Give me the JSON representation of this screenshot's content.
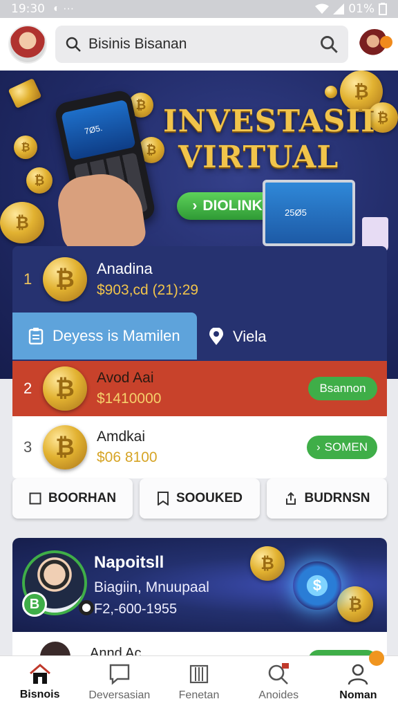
{
  "status": {
    "time": "19:30",
    "battery": "01%"
  },
  "header": {
    "search_text": "Bisinis Bisanan"
  },
  "hero": {
    "title_line1": "INVESTASII",
    "title_line2": "VIRTUAL",
    "cta_label": "DIOLINKS",
    "phone_screen": "7Ø5.",
    "laptop_screen": "25Ø5"
  },
  "list": {
    "rows": [
      {
        "rank": "1",
        "name": "Anadina",
        "value": "$903,cd (21):29"
      },
      {
        "rank": "2",
        "name": "Avod Aai",
        "value": "$1410000",
        "action": "Bsannon"
      },
      {
        "rank": "3",
        "name": "Amdkai",
        "value": "$06 8100",
        "action": "SOMEN"
      }
    ],
    "tabs": [
      {
        "label": "Deyess is Mamilen"
      },
      {
        "label": "Viela"
      }
    ]
  },
  "actions": [
    {
      "label": "BOORHAN"
    },
    {
      "label": "SOOUKED"
    },
    {
      "label": "BUDRNSN"
    }
  ],
  "featured": {
    "title": "Napoitsll",
    "subtitle": "Biagiin, Mnuupaal",
    "phone": "F2,-600-1955",
    "badge": "B",
    "glow_symbol": "$"
  },
  "peek": {
    "name": "Annd Ac"
  },
  "bottom_nav": [
    {
      "label": "Bisnois",
      "icon": "home-icon",
      "active": true
    },
    {
      "label": "Deversasian",
      "icon": "chat-icon",
      "active": false
    },
    {
      "label": "Fenetan",
      "icon": "documents-icon",
      "active": false
    },
    {
      "label": "Anoides",
      "icon": "search-icon",
      "active": false
    },
    {
      "label": "Noman",
      "icon": "user-icon",
      "active": false
    }
  ],
  "colors": {
    "accent_green": "#3fae48",
    "hero_bg": "#202a66",
    "gold": "#f1c44b",
    "row_red": "#c8422b",
    "tab_blue": "#5ea3db"
  }
}
